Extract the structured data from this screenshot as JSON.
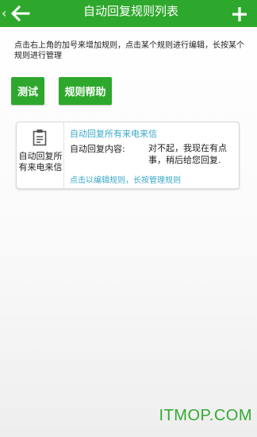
{
  "header": {
    "title": "自动回复规则列表",
    "back_chevron": "‹",
    "back_icon": "back-arrow-icon",
    "add_icon": "plus-icon",
    "bg_color": "#2ea82c"
  },
  "hint": {
    "text": "点击右上角的加号来增加规则，点击某个规则进行编辑，长按某个规则进行管理"
  },
  "buttons": {
    "test_label": "测试",
    "help_label": "规则帮助"
  },
  "rule": {
    "icon": "clipboard-icon",
    "type_label": "自动回复所有来电来信",
    "name": "自动回复所有来电来信",
    "content_label": "自动回复内容:",
    "content_value": "对不起，我现在有点事，稍后给您回复.",
    "action_hint": "点击以编辑规则，长按管理规则"
  },
  "watermark": {
    "text": "ITMOP.COM"
  },
  "colors": {
    "accent": "#2ea82c",
    "link": "#3aa8c9"
  }
}
